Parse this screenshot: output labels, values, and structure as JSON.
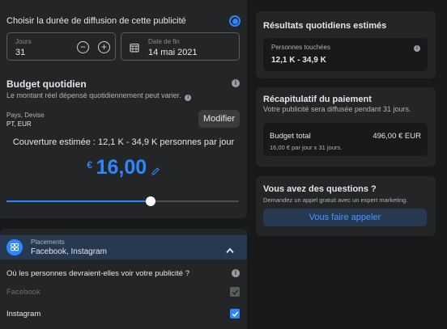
{
  "duration": {
    "option_label": "Choisir la durée de diffusion de cette publicité",
    "days_label": "Jours",
    "days_value": "31",
    "end_date_label": "Date de fin",
    "end_date_value": "14 mai 2021"
  },
  "budget": {
    "title": "Budget quotidien",
    "note": "Le montant réel dépensé quotidiennement peut varier.",
    "country_currency_label": "Pays, Devise",
    "country_currency_value": "PT, EUR",
    "modify_label": "Modifier",
    "coverage": "Couverture estimée : 12,1 K - 34,9 K personnes par jour",
    "currency_symbol": "€",
    "amount": "16,00",
    "slider_fraction": 0.62
  },
  "placements": {
    "label": "Placements",
    "value": "Facebook, Instagram",
    "question": "Où les personnes devraient-elles voir votre publicité ?",
    "items": [
      {
        "label": "Facebook",
        "checked": true,
        "disabled": true
      },
      {
        "label": "Instagram",
        "checked": true,
        "disabled": false
      }
    ]
  },
  "results": {
    "title": "Résultats quotidiens estimés",
    "reach_label": "Personnes touchées",
    "reach_value": "12,1 K - 34,9 K"
  },
  "payment": {
    "title": "Récapitulatif du paiement",
    "subtitle": "Votre publicité sera diffusée pendant 31 jours.",
    "total_label": "Budget total",
    "total_value": "496,00 € EUR",
    "breakdown": "16,00 € par jour x 31 jours."
  },
  "questions": {
    "title": "Vous avez des questions ?",
    "subtitle": "Demandez un appel gratuit avec un expert marketing.",
    "call_button": "Vous faire appeler"
  },
  "colors": {
    "accent": "#2d88ff",
    "background": "#18191a",
    "panel": "#242526"
  }
}
